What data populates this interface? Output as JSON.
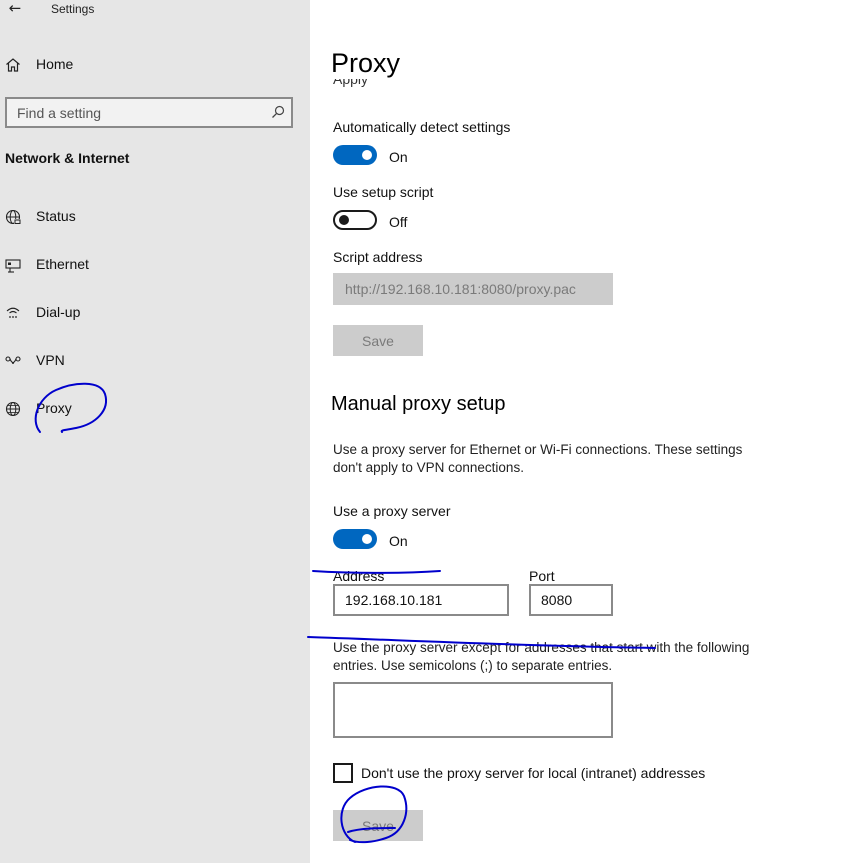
{
  "window": {
    "title": "Settings",
    "back_glyph": "←"
  },
  "sidebar": {
    "home_label": "Home",
    "search": {
      "placeholder": "Find a setting",
      "icon": "search-icon"
    },
    "section_title": "Network & Internet",
    "items": [
      {
        "label": "Status",
        "icon": "globe-status-icon"
      },
      {
        "label": "Ethernet",
        "icon": "ethernet-icon"
      },
      {
        "label": "Dial-up",
        "icon": "dialup-icon"
      },
      {
        "label": "VPN",
        "icon": "vpn-icon"
      },
      {
        "label": "Proxy",
        "icon": "globe-icon"
      }
    ]
  },
  "main": {
    "page_title": "Proxy",
    "cut_text": "Apply",
    "auto": {
      "detect_label": "Automatically detect settings",
      "detect_state": "On",
      "script_label": "Use setup script",
      "script_state": "Off",
      "address_label": "Script address",
      "address_value": "http://192.168.10.181:8080/proxy.pac",
      "save_label": "Save"
    },
    "manual": {
      "heading": "Manual proxy setup",
      "description_line1": "Use a proxy server for Ethernet or Wi-Fi connections. These settings",
      "description_line2": "don't apply to VPN connections.",
      "use_proxy_label": "Use a proxy server",
      "use_proxy_state": "On",
      "address_label": "Address",
      "address_value": "192.168.10.181",
      "port_label": "Port",
      "port_value": "8080",
      "exceptions_line1": "Use the proxy server except for addresses that start with the following",
      "exceptions_line2": "entries. Use semicolons (;) to separate entries.",
      "exceptions_value": "",
      "local_checkbox_label": "Don't use the proxy server for local (intranet) addresses",
      "save_label": "Save"
    }
  },
  "colors": {
    "accent": "#0067c0",
    "annotation": "#0000cc",
    "sidebar_bg": "#e6e6e6"
  }
}
